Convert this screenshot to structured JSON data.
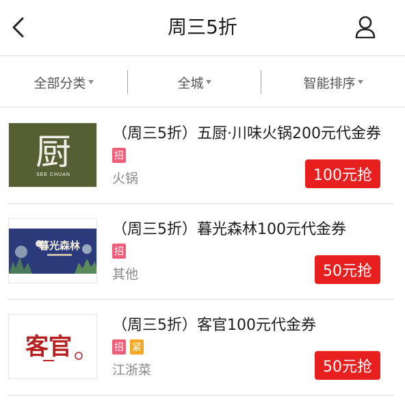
{
  "header": {
    "title": "周三5折"
  },
  "filters": [
    {
      "label": "全部分类"
    },
    {
      "label": "全城"
    },
    {
      "label": "智能排序"
    }
  ],
  "items": [
    {
      "name": "（周三5折）五厨·川味火锅200元代金券",
      "tags": [
        "招"
      ],
      "category": "火锅",
      "price_button": "100元抢",
      "logo": {
        "big": "厨",
        "small": "SEE CHUAN"
      }
    },
    {
      "name": "（周三5折）暮光森林100元代金券",
      "tags": [
        "招"
      ],
      "category": "其他",
      "price_button": "50元抢",
      "logo": {
        "big": "暮光森林"
      }
    },
    {
      "name": "（周三5折）客官100元代金券",
      "tags": [
        "招",
        "紧"
      ],
      "category": "江浙菜",
      "price_button": "50元抢",
      "logo": {
        "big": "客官"
      }
    }
  ],
  "colors": {
    "accent_red": "#e71f1f",
    "tag_pink": "#f05d78",
    "tag_orange": "#f5a623",
    "logo1_bg": "#565e34"
  }
}
